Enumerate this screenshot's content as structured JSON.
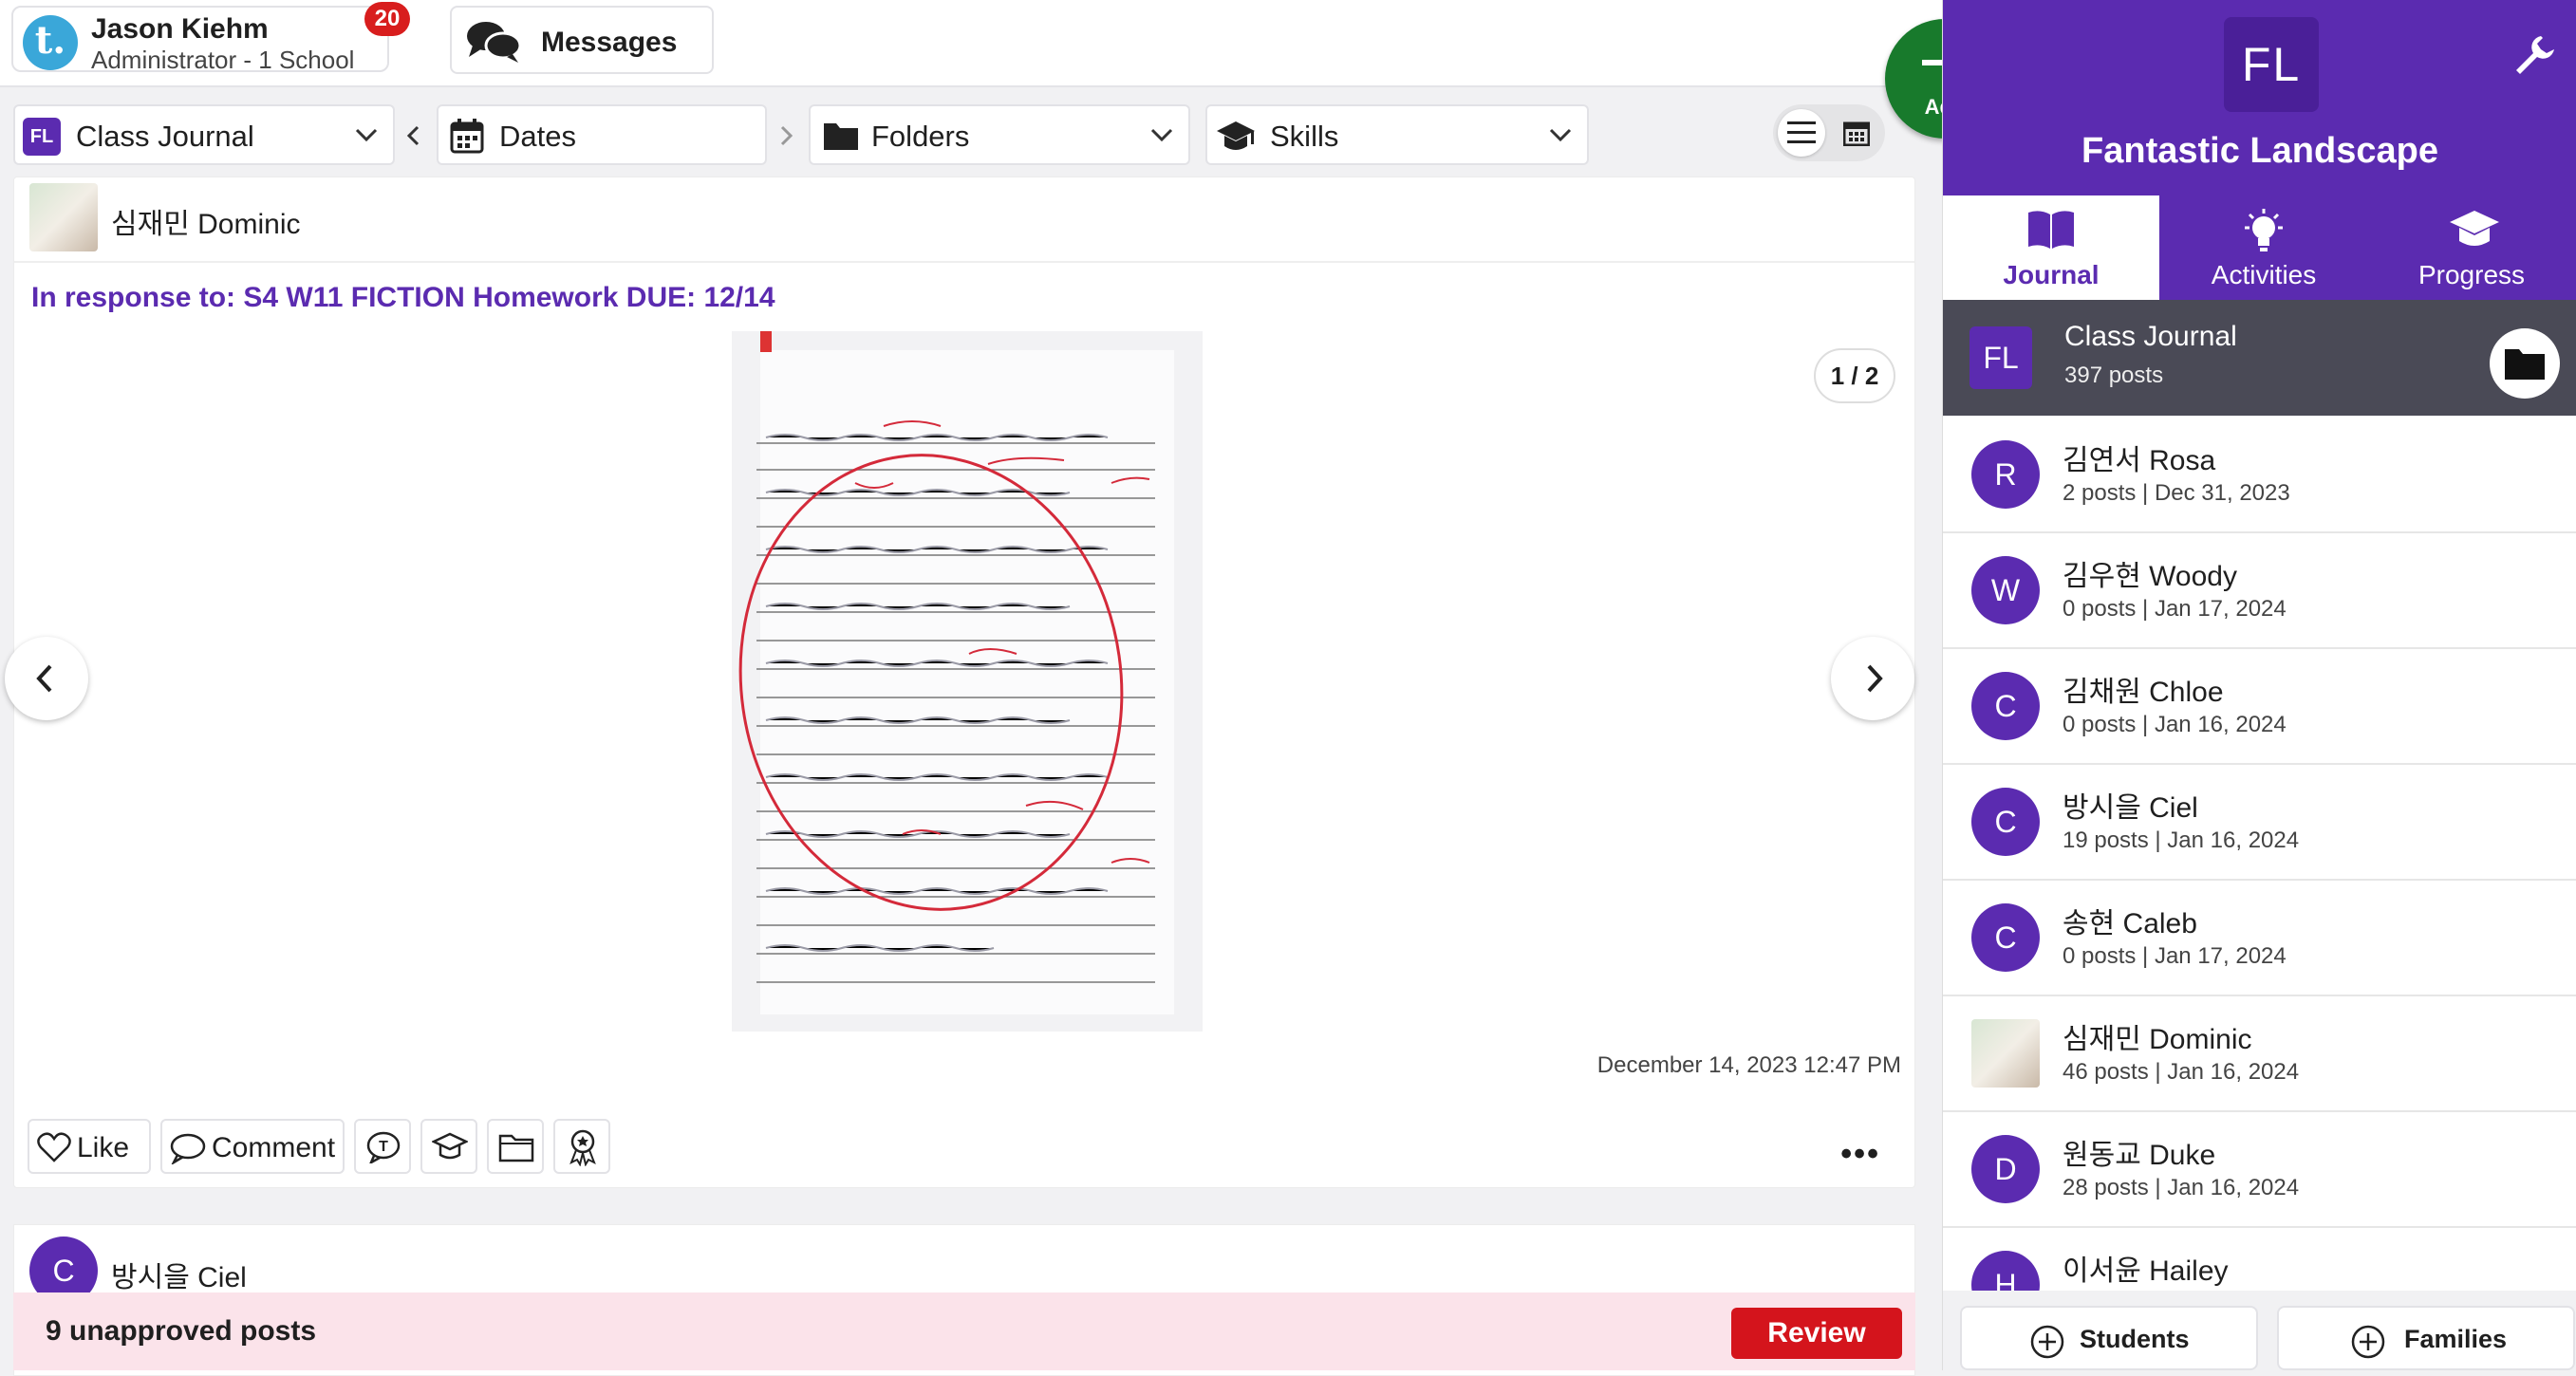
{
  "user": {
    "logo_letter": "t.",
    "name": "Jason Kiehm",
    "role": "Administrator - 1 School",
    "notifications": "20"
  },
  "messages": {
    "label": "Messages"
  },
  "filters": {
    "journal": {
      "badge": "FL",
      "label": "Class Journal"
    },
    "dates": "Dates",
    "folders": "Folders",
    "skills": "Skills"
  },
  "add_button": {
    "label": "Add"
  },
  "post": {
    "author": "심재민 Dominic",
    "response": "In response to: S4 W11 FICTION Homework DUE: 12/14",
    "page_counter": "1 / 2",
    "date": "December 14, 2023 12:47 PM",
    "actions": {
      "like": "Like",
      "comment": "Comment"
    },
    "more": "•••"
  },
  "post2": {
    "avatar": "C",
    "author": "방시을 Ciel"
  },
  "unapproved": {
    "text": "9 unapproved posts",
    "button": "Review"
  },
  "sidebar": {
    "logo": "FL",
    "title": "Fantastic Landscape",
    "tabs": [
      {
        "label": "Journal",
        "icon": "book-icon"
      },
      {
        "label": "Activities",
        "icon": "lightbulb-icon"
      },
      {
        "label": "Progress",
        "icon": "graduation-cap-icon"
      }
    ],
    "class_journal": {
      "logo": "FL",
      "name": "Class Journal",
      "sub": "397 posts"
    },
    "students": [
      {
        "initial": "R",
        "name": "김연서 Rosa",
        "sub": "2 posts | Dec 31, 2023"
      },
      {
        "initial": "W",
        "name": "김우현 Woody",
        "sub": "0 posts | Jan 17, 2024"
      },
      {
        "initial": "C",
        "name": "김채원 Chloe",
        "sub": "0 posts | Jan 16, 2024"
      },
      {
        "initial": "C",
        "name": "방시을 Ciel",
        "sub": "19 posts | Jan 16, 2024"
      },
      {
        "initial": "C",
        "name": "송현 Caleb",
        "sub": "0 posts | Jan 17, 2024"
      },
      {
        "initial": "",
        "name": "심재민 Dominic",
        "sub": "46 posts | Jan 16, 2024"
      },
      {
        "initial": "D",
        "name": "원동교 Duke",
        "sub": "28 posts | Jan 16, 2024"
      },
      {
        "initial": "H",
        "name": "이서윤 Hailey",
        "sub": ""
      }
    ],
    "footer": {
      "students": "Students",
      "families": "Families"
    }
  },
  "colors": {
    "accent": "#5b2bb0",
    "add": "#187a2c",
    "review": "#d4141c",
    "unapproved_bg": "#fbe3ea"
  }
}
